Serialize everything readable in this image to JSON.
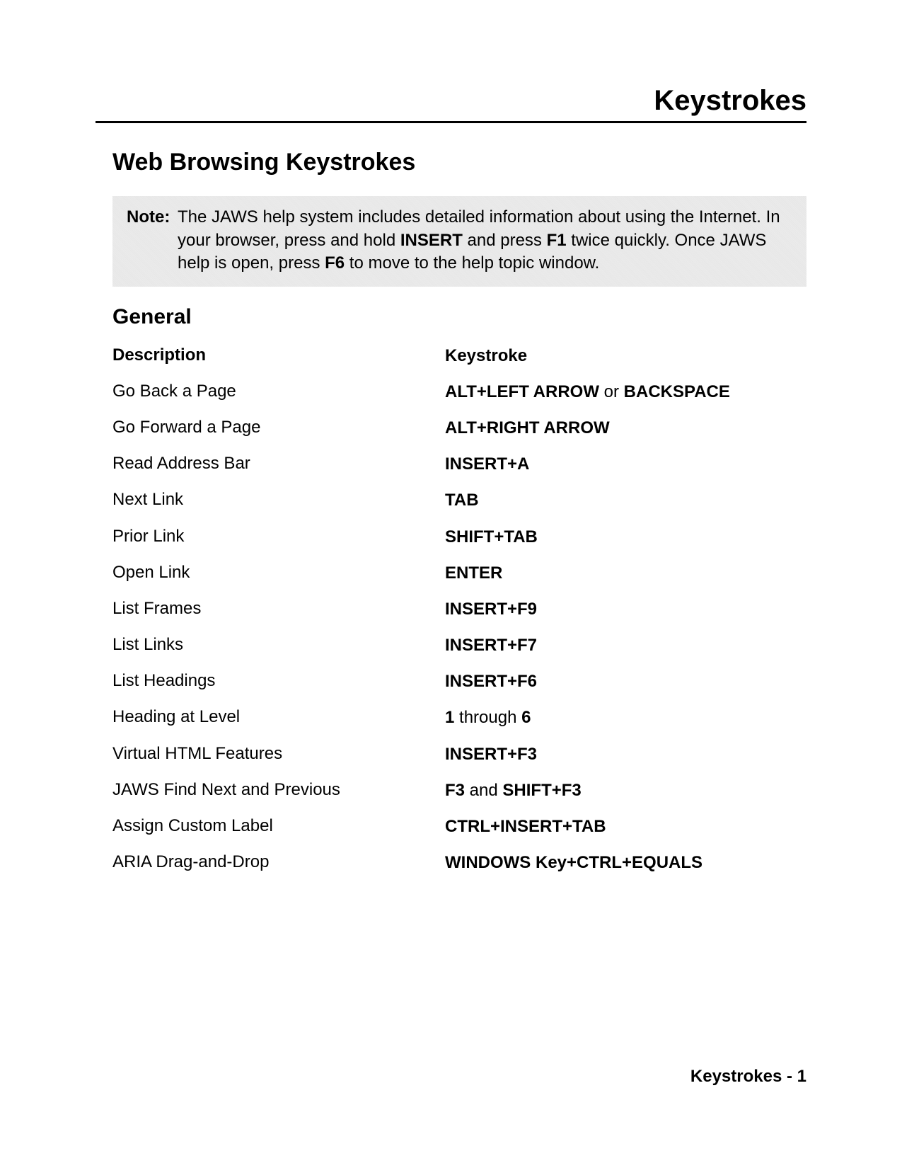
{
  "chapter_title": "Keystrokes",
  "section_title": "Web Browsing Keystrokes",
  "note": {
    "label": "Note:",
    "seg1": "The JAWS help system includes detailed information about using the Internet. In your browser, press and hold ",
    "bold1": "INSERT",
    "seg2": " and press ",
    "bold2": "F1",
    "seg3": " twice quickly. Once JAWS help is open, press ",
    "bold3": "F6",
    "seg4": " to move to the help topic window."
  },
  "sub_title": "General",
  "headers": {
    "desc": "Description",
    "keys": "Keystroke"
  },
  "rows": [
    {
      "desc": "Go Back a Page",
      "k": [
        {
          "t": "ALT+LEFT ARROW",
          "b": true
        },
        {
          "t": " or ",
          "b": false
        },
        {
          "t": "BACKSPACE",
          "b": true
        }
      ]
    },
    {
      "desc": "Go Forward a Page",
      "k": [
        {
          "t": "ALT+RIGHT ARROW",
          "b": true
        }
      ]
    },
    {
      "desc": "Read Address Bar",
      "k": [
        {
          "t": "INSERT+A",
          "b": true
        }
      ]
    },
    {
      "desc": "Next Link",
      "k": [
        {
          "t": "TAB",
          "b": true
        }
      ]
    },
    {
      "desc": "Prior Link",
      "k": [
        {
          "t": "SHIFT+TAB",
          "b": true
        }
      ]
    },
    {
      "desc": "Open Link",
      "k": [
        {
          "t": "ENTER",
          "b": true
        }
      ]
    },
    {
      "desc": "List Frames",
      "k": [
        {
          "t": "INSERT+F9",
          "b": true
        }
      ]
    },
    {
      "desc": "List Links",
      "k": [
        {
          "t": "INSERT+F7",
          "b": true
        }
      ]
    },
    {
      "desc": "List Headings",
      "k": [
        {
          "t": "INSERT+F6",
          "b": true
        }
      ]
    },
    {
      "desc": "Heading at Level",
      "k": [
        {
          "t": "1",
          "b": true
        },
        {
          "t": " through ",
          "b": false
        },
        {
          "t": "6",
          "b": true
        }
      ]
    },
    {
      "desc": "Virtual HTML Features",
      "k": [
        {
          "t": "INSERT+F3",
          "b": true
        }
      ]
    },
    {
      "desc": "JAWS Find Next and Previous",
      "k": [
        {
          "t": "F3",
          "b": true
        },
        {
          "t": " and ",
          "b": false
        },
        {
          "t": "SHIFT+F3",
          "b": true
        }
      ]
    },
    {
      "desc": "Assign Custom Label",
      "k": [
        {
          "t": "CTRL+INSERT+TAB",
          "b": true
        }
      ]
    },
    {
      "desc": "ARIA Drag-and-Drop",
      "k": [
        {
          "t": "WINDOWS Key+CTRL+EQUALS",
          "b": true
        }
      ]
    }
  ],
  "footer": "Keystrokes - 1"
}
